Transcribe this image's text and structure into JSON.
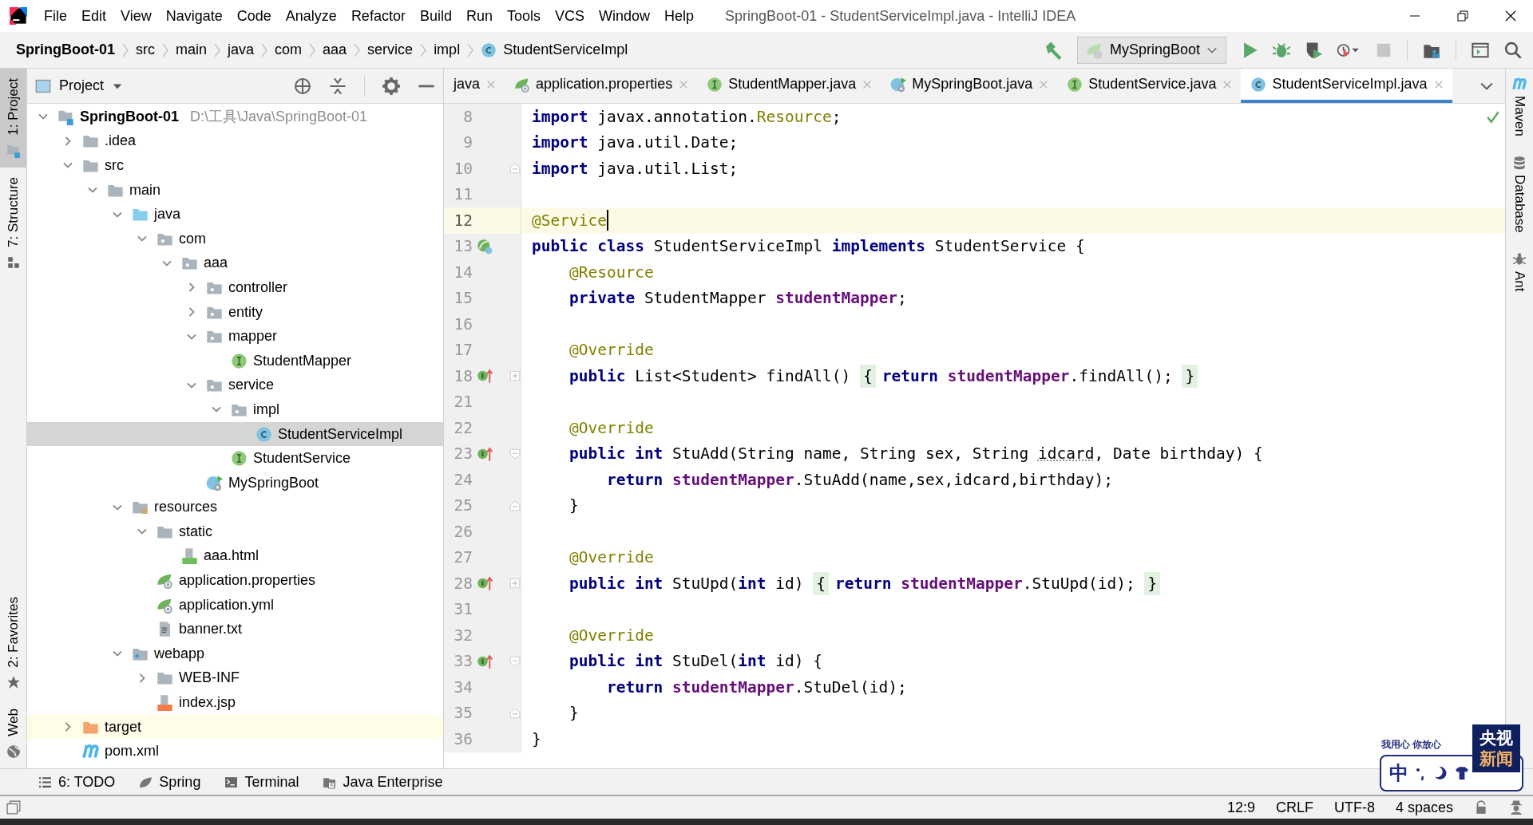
{
  "window": {
    "title": "SpringBoot-01 - StudentServiceImpl.java - IntelliJ IDEA"
  },
  "menu": [
    "File",
    "Edit",
    "View",
    "Navigate",
    "Code",
    "Analyze",
    "Refactor",
    "Build",
    "Run",
    "Tools",
    "VCS",
    "Window",
    "Help"
  ],
  "breadcrumbs": [
    {
      "label": "SpringBoot-01",
      "kind": "project"
    },
    {
      "label": "src",
      "kind": "folder"
    },
    {
      "label": "main",
      "kind": "folder"
    },
    {
      "label": "java",
      "kind": "folder"
    },
    {
      "label": "com",
      "kind": "folder"
    },
    {
      "label": "aaa",
      "kind": "folder"
    },
    {
      "label": "service",
      "kind": "folder"
    },
    {
      "label": "impl",
      "kind": "folder"
    },
    {
      "label": "StudentServiceImpl",
      "kind": "class"
    }
  ],
  "run_config": {
    "label": "MySpringBoot"
  },
  "left_tool_windows": {
    "top": [
      {
        "label": "1: Project",
        "kind": "project",
        "selected": true
      },
      {
        "label": "7: Structure",
        "kind": "structure",
        "selected": false
      }
    ],
    "bottom": [
      {
        "label": "2: Favorites",
        "kind": "favorites",
        "selected": false
      },
      {
        "label": "Web",
        "kind": "web",
        "selected": false
      }
    ]
  },
  "project_panel": {
    "title": "Project",
    "tree": [
      {
        "label": "SpringBoot-01",
        "kind": "module",
        "path": "D:\\工具\\Java\\SpringBoot-01",
        "expanded": true,
        "selected": false,
        "children": [
          {
            "label": ".idea",
            "kind": "folder",
            "expanded": false,
            "selected": false
          },
          {
            "label": "src",
            "kind": "folder",
            "expanded": true,
            "selected": false,
            "children": [
              {
                "label": "main",
                "kind": "folder",
                "expanded": true,
                "selected": false,
                "children": [
                  {
                    "label": "java",
                    "kind": "source-folder",
                    "expanded": true,
                    "selected": false,
                    "children": [
                      {
                        "label": "com",
                        "kind": "package",
                        "expanded": true,
                        "selected": false,
                        "children": [
                          {
                            "label": "aaa",
                            "kind": "package",
                            "expanded": true,
                            "selected": false,
                            "children": [
                              {
                                "label": "controller",
                                "kind": "package",
                                "expanded": false,
                                "selected": false
                              },
                              {
                                "label": "entity",
                                "kind": "package",
                                "expanded": false,
                                "selected": false
                              },
                              {
                                "label": "mapper",
                                "kind": "package",
                                "expanded": true,
                                "selected": false,
                                "children": [
                                  {
                                    "label": "StudentMapper",
                                    "kind": "interface",
                                    "selected": false
                                  }
                                ]
                              },
                              {
                                "label": "service",
                                "kind": "package",
                                "expanded": true,
                                "selected": false,
                                "children": [
                                  {
                                    "label": "impl",
                                    "kind": "package",
                                    "expanded": true,
                                    "selected": false,
                                    "children": [
                                      {
                                        "label": "StudentServiceImpl",
                                        "kind": "class",
                                        "selected": true
                                      }
                                    ]
                                  },
                                  {
                                    "label": "StudentService",
                                    "kind": "interface",
                                    "selected": false
                                  }
                                ]
                              },
                              {
                                "label": "MySpringBoot",
                                "kind": "spring-class",
                                "selected": false
                              }
                            ]
                          }
                        ]
                      }
                    ]
                  },
                  {
                    "label": "resources",
                    "kind": "resources-folder",
                    "expanded": true,
                    "selected": false,
                    "children": [
                      {
                        "label": "static",
                        "kind": "folder",
                        "expanded": true,
                        "selected": false,
                        "children": [
                          {
                            "label": "aaa.html",
                            "kind": "html",
                            "selected": false
                          }
                        ]
                      },
                      {
                        "label": "application.properties",
                        "kind": "spring-config",
                        "selected": false
                      },
                      {
                        "label": "application.yml",
                        "kind": "spring-config",
                        "selected": false
                      },
                      {
                        "label": "banner.txt",
                        "kind": "text",
                        "selected": false
                      }
                    ]
                  },
                  {
                    "label": "webapp",
                    "kind": "web-folder",
                    "expanded": true,
                    "selected": false,
                    "children": [
                      {
                        "label": "WEB-INF",
                        "kind": "folder",
                        "expanded": false,
                        "selected": false
                      },
                      {
                        "label": "index.jsp",
                        "kind": "jsp",
                        "selected": false
                      }
                    ]
                  }
                ]
              }
            ]
          },
          {
            "label": "target",
            "kind": "excluded-folder",
            "expanded": false,
            "selected": false
          },
          {
            "label": "pom.xml",
            "kind": "maven",
            "selected": false
          }
        ]
      }
    ]
  },
  "editor_tabs": [
    {
      "label": "java",
      "kind": "file",
      "selected": false
    },
    {
      "label": "application.properties",
      "kind": "spring-config",
      "selected": false
    },
    {
      "label": "StudentMapper.java",
      "kind": "interface",
      "selected": false
    },
    {
      "label": "MySpringBoot.java",
      "kind": "spring-class",
      "selected": false
    },
    {
      "label": "StudentService.java",
      "kind": "interface",
      "selected": false
    },
    {
      "label": "StudentServiceImpl.java",
      "kind": "class",
      "selected": true
    }
  ],
  "code_lines": [
    {
      "number": "8",
      "current": false,
      "tokens": [
        {
          "kind": "keyword",
          "text": "import"
        },
        {
          "kind": "plain",
          "text": " javax.annotation."
        },
        {
          "kind": "annotation",
          "text": "Resource"
        },
        {
          "kind": "plain",
          "text": ";"
        }
      ]
    },
    {
      "number": "9",
      "current": false,
      "tokens": [
        {
          "kind": "keyword",
          "text": "import"
        },
        {
          "kind": "plain",
          "text": " java.util.Date;"
        }
      ]
    },
    {
      "number": "10",
      "current": false,
      "fold_icon": {
        "kind": "end"
      },
      "tokens": [
        {
          "kind": "keyword",
          "text": "import"
        },
        {
          "kind": "plain",
          "text": " java.util.List;"
        }
      ]
    },
    {
      "number": "11",
      "current": false
    },
    {
      "number": "12",
      "current": true,
      "tokens": [
        {
          "kind": "annotation",
          "text": "@Service"
        }
      ]
    },
    {
      "number": "13",
      "current": false,
      "gutter_icon": {
        "kind": "bean"
      },
      "tokens": [
        {
          "kind": "keyword",
          "text": "public class"
        },
        {
          "kind": "plain",
          "text": " StudentServiceImpl "
        },
        {
          "kind": "keyword",
          "text": "implements"
        },
        {
          "kind": "plain",
          "text": " StudentService {"
        }
      ]
    },
    {
      "number": "14",
      "current": false,
      "tokens": [
        {
          "kind": "annotation",
          "text": "    @Resource"
        }
      ]
    },
    {
      "number": "15",
      "current": false,
      "tokens": [
        {
          "kind": "keyword",
          "text": "    private"
        },
        {
          "kind": "plain",
          "text": " StudentMapper "
        },
        {
          "kind": "field",
          "text": "studentMapper"
        },
        {
          "kind": "plain",
          "text": ";"
        }
      ]
    },
    {
      "number": "16",
      "current": false
    },
    {
      "number": "17",
      "current": false,
      "tokens": [
        {
          "kind": "annotation",
          "text": "    @Override"
        }
      ]
    },
    {
      "number": "18",
      "current": false,
      "gutter_icon": {
        "kind": "implements"
      },
      "fold_icon": {
        "kind": "collapsed"
      },
      "tokens": [
        {
          "kind": "keyword",
          "text": "    public"
        },
        {
          "kind": "plain",
          "text": " List<Student> findAll() "
        },
        {
          "kind": "folded",
          "text": "{"
        },
        {
          "kind": "keyword",
          "text": "return"
        },
        {
          "kind": "field",
          "text": " studentMapper"
        },
        {
          "kind": "plain",
          "text": ".findAll(); "
        },
        {
          "kind": "folded",
          "text": "}"
        }
      ]
    },
    {
      "number": "21",
      "current": false
    },
    {
      "number": "22",
      "current": false,
      "tokens": [
        {
          "kind": "annotation",
          "text": "    @Override"
        }
      ]
    },
    {
      "number": "23",
      "current": false,
      "gutter_icon": {
        "kind": "implements"
      },
      "fold_icon": {
        "kind": "start"
      },
      "tokens": [
        {
          "kind": "keyword",
          "text": "    public int"
        },
        {
          "kind": "plain",
          "text": " StuAdd(String name, String sex, String "
        },
        {
          "kind": "typo",
          "text": "idcard"
        },
        {
          "kind": "plain",
          "text": ", Date birthday) {"
        }
      ]
    },
    {
      "number": "24",
      "current": false,
      "tokens": [
        {
          "kind": "keyword",
          "text": "        return"
        },
        {
          "kind": "field",
          "text": " studentMapper"
        },
        {
          "kind": "plain",
          "text": ".StuAdd(name,sex,idcard,birthday);"
        }
      ]
    },
    {
      "number": "25",
      "current": false,
      "fold_icon": {
        "kind": "end"
      },
      "tokens": [
        {
          "kind": "plain",
          "text": "    }"
        }
      ]
    },
    {
      "number": "26",
      "current": false
    },
    {
      "number": "27",
      "current": false,
      "tokens": [
        {
          "kind": "annotation",
          "text": "    @Override"
        }
      ]
    },
    {
      "number": "28",
      "current": false,
      "gutter_icon": {
        "kind": "implements"
      },
      "fold_icon": {
        "kind": "collapsed"
      },
      "tokens": [
        {
          "kind": "keyword",
          "text": "    public int"
        },
        {
          "kind": "plain",
          "text": " StuUpd("
        },
        {
          "kind": "keyword",
          "text": "int"
        },
        {
          "kind": "plain",
          "text": " id) "
        },
        {
          "kind": "folded",
          "text": "{"
        },
        {
          "kind": "keyword",
          "text": "return"
        },
        {
          "kind": "field",
          "text": " studentMapper"
        },
        {
          "kind": "plain",
          "text": ".StuUpd(id); "
        },
        {
          "kind": "folded",
          "text": "}"
        }
      ]
    },
    {
      "number": "31",
      "current": false
    },
    {
      "number": "32",
      "current": false,
      "tokens": [
        {
          "kind": "annotation",
          "text": "    @Override"
        }
      ]
    },
    {
      "number": "33",
      "current": false,
      "gutter_icon": {
        "kind": "implements"
      },
      "fold_icon": {
        "kind": "start"
      },
      "tokens": [
        {
          "kind": "keyword",
          "text": "    public int"
        },
        {
          "kind": "plain",
          "text": " StuDel("
        },
        {
          "kind": "keyword",
          "text": "int"
        },
        {
          "kind": "plain",
          "text": " id) {"
        }
      ]
    },
    {
      "number": "34",
      "current": false,
      "tokens": [
        {
          "kind": "keyword",
          "text": "        return"
        },
        {
          "kind": "field",
          "text": " studentMapper"
        },
        {
          "kind": "plain",
          "text": ".StuDel(id);"
        }
      ]
    },
    {
      "number": "35",
      "current": false,
      "fold_icon": {
        "kind": "end"
      },
      "tokens": [
        {
          "kind": "plain",
          "text": "    }"
        }
      ]
    },
    {
      "number": "36",
      "current": false,
      "tokens": [
        {
          "kind": "plain",
          "text": "}"
        }
      ]
    }
  ],
  "right_tool_windows": [
    {
      "label": "Maven",
      "kind": "maven"
    },
    {
      "label": "Database",
      "kind": "database"
    },
    {
      "label": "Ant",
      "kind": "ant"
    }
  ],
  "bottom_tool_windows": [
    {
      "label": "6: TODO",
      "kind": "todo"
    },
    {
      "label": "Spring",
      "kind": "spring"
    },
    {
      "label": "Terminal",
      "kind": "terminal"
    },
    {
      "label": "Java Enterprise",
      "kind": "enterprise"
    }
  ],
  "status_bar": {
    "caret": "12:9",
    "line_separator": "CRLF",
    "encoding": "UTF-8",
    "indent": "4 spaces"
  },
  "ime": {
    "slogan": "我用心 你放心",
    "mode": "中",
    "badge": [
      "央视",
      "新闻"
    ]
  }
}
